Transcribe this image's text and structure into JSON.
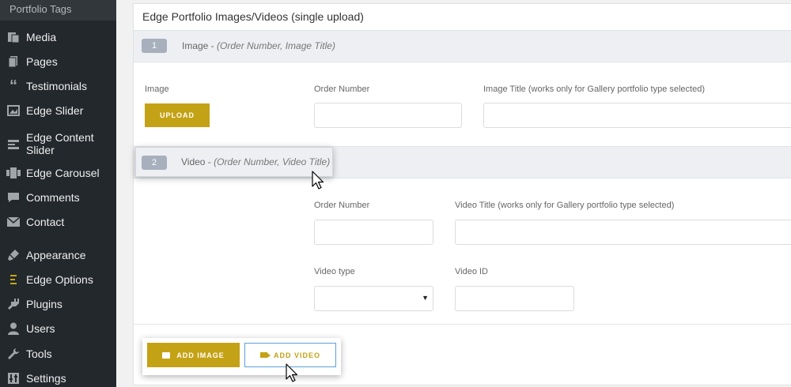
{
  "sidebar": {
    "top_label": "Portfolio Tags",
    "items": [
      {
        "label": "Media",
        "icon": "media-icon"
      },
      {
        "label": "Pages",
        "icon": "pages-icon"
      },
      {
        "label": "Testimonials",
        "icon": "quote-icon"
      },
      {
        "label": "Edge Slider",
        "icon": "slider-icon"
      },
      {
        "label": "Edge Content Slider",
        "icon": "content-slider-icon"
      },
      {
        "label": "Edge Carousel",
        "icon": "carousel-icon"
      },
      {
        "label": "Comments",
        "icon": "comments-icon"
      },
      {
        "label": "Contact",
        "icon": "mail-icon"
      },
      {
        "label": "Appearance",
        "icon": "brush-icon"
      },
      {
        "label": "Edge Options",
        "icon": "edge-logo-icon"
      },
      {
        "label": "Plugins",
        "icon": "plugin-icon"
      },
      {
        "label": "Users",
        "icon": "user-icon"
      },
      {
        "label": "Tools",
        "icon": "wrench-icon"
      },
      {
        "label": "Settings",
        "icon": "settings-icon"
      }
    ]
  },
  "panel": {
    "title": "Edge Portfolio Images/Videos (single upload)",
    "image_row": {
      "number": "1",
      "title": "Image - ",
      "subtitle": "(Order Number, Image Title)",
      "image_label": "Image",
      "upload_label": "UPLOAD",
      "order_label": "Order Number",
      "title_label": "Image Title (works only for Gallery portfolio type selected)",
      "order_value": "",
      "title_value": ""
    },
    "video_row": {
      "number": "2",
      "title": "Video - ",
      "subtitle": "(Order Number, Video Title)",
      "order_label": "Order Number",
      "title_label": "Video Title (works only for Gallery portfolio type selected)",
      "type_label": "Video type",
      "id_label": "Video ID",
      "order_value": "",
      "title_value": "",
      "type_value": "",
      "id_value": ""
    },
    "add_image_label": "ADD IMAGE",
    "add_video_label": "ADD VIDEO"
  },
  "colors": {
    "accent": "#c4a215",
    "sidebar_bg": "#23282d",
    "focus_border": "#5aa2d5"
  }
}
